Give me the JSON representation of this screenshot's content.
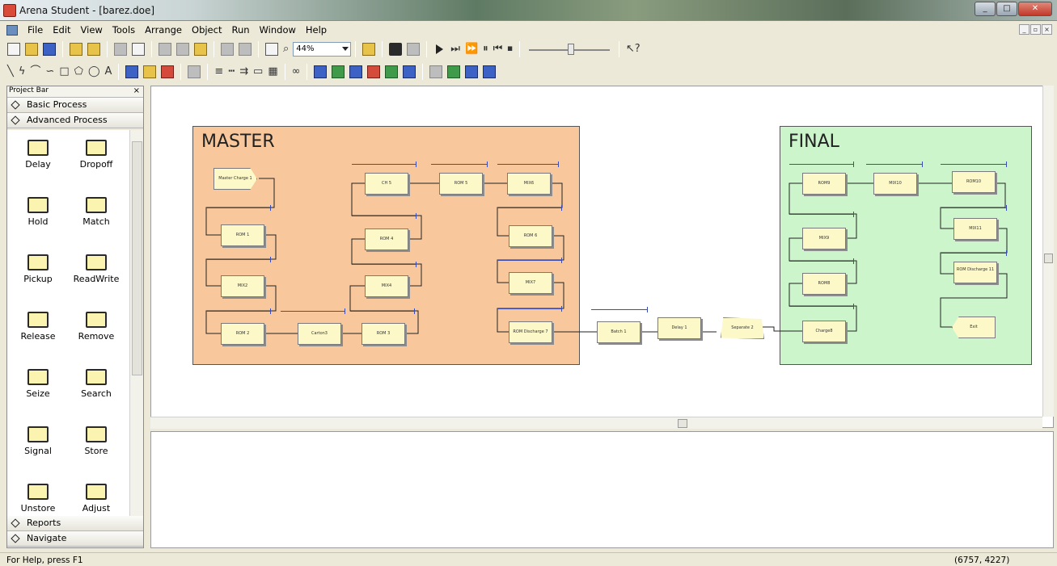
{
  "window": {
    "title": "Arena Student - [barez.doe]"
  },
  "menu": [
    "File",
    "Edit",
    "View",
    "Tools",
    "Arrange",
    "Object",
    "Run",
    "Window",
    "Help"
  ],
  "toolbar": {
    "zoom": "44%"
  },
  "project_bar": {
    "title": "Project Bar",
    "panels": [
      "Basic Process",
      "Advanced Process"
    ],
    "modules": [
      "Delay",
      "Dropoff",
      "Hold",
      "Match",
      "Pickup",
      "ReadWrite",
      "Release",
      "Remove",
      "Seize",
      "Search",
      "Signal",
      "Store",
      "Unstore",
      "Adjust"
    ],
    "bottom_panels": [
      "Reports",
      "Navigate"
    ]
  },
  "model": {
    "regions": [
      "MASTER",
      "FINAL"
    ],
    "nodes": [
      "Master Charge 1",
      "ROM 1",
      "MIX2",
      "ROM 2",
      "Carton3",
      "ROM 3",
      "MIX4",
      "ROM 4",
      "CH 5",
      "ROM 5",
      "MIX6",
      "ROM 6",
      "MIX7",
      "ROM Discharge 7",
      "Batch 1",
      "Delay 1",
      "Separate 2",
      "ROM9",
      "MIX10",
      "ROM10",
      "MIX9",
      "MIX11",
      "ROM8",
      "ROM Discharge 11",
      "Charge8",
      "Exit"
    ]
  },
  "status": {
    "help": "For Help, press F1",
    "coords": "(6757, 4227)"
  }
}
